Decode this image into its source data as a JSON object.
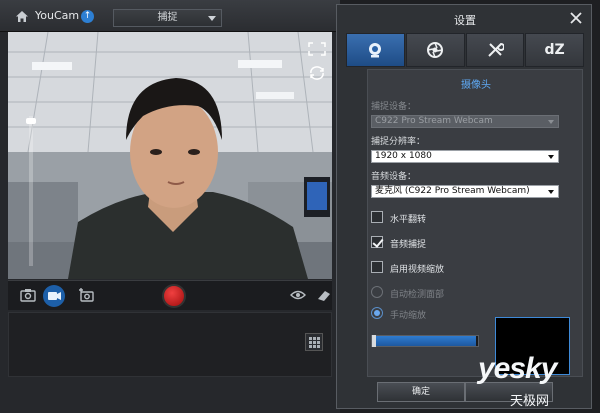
{
  "app": {
    "title": "YouCam",
    "mode": "捕捉"
  },
  "dialog": {
    "title": "设置",
    "tabs": [
      {
        "name": "webcam-tab",
        "icon": "webcam-icon",
        "active": true
      },
      {
        "name": "effects-tab",
        "icon": "aperture-icon",
        "active": false
      },
      {
        "name": "tools-tab",
        "icon": "tools-icon",
        "active": false
      },
      {
        "name": "dz-tab",
        "label": "dZ",
        "active": false
      }
    ],
    "section_title": "摄像头",
    "capture_device_label": "捕捉设备：",
    "capture_device_value": "C922 Pro Stream Webcam",
    "resolution_label": "捕捉分辨率：",
    "resolution_value": "1920 x 1080",
    "audio_device_label": "音频设备：",
    "audio_device_value": "麦克风 (C922 Pro Stream Webcam)",
    "options": [
      {
        "label": "水平翻转",
        "checked": false
      },
      {
        "label": "音频捕捉",
        "checked": true
      },
      {
        "label": "启用视频缩放",
        "checked": false
      }
    ],
    "radios": [
      {
        "label": "自动检测面部",
        "selected": false
      },
      {
        "label": "手动缩放",
        "selected": true
      }
    ],
    "ok_button": "确定",
    "zoom_level": 0.98
  },
  "watermark": {
    "main": "yesky",
    "sub": "天极网"
  }
}
